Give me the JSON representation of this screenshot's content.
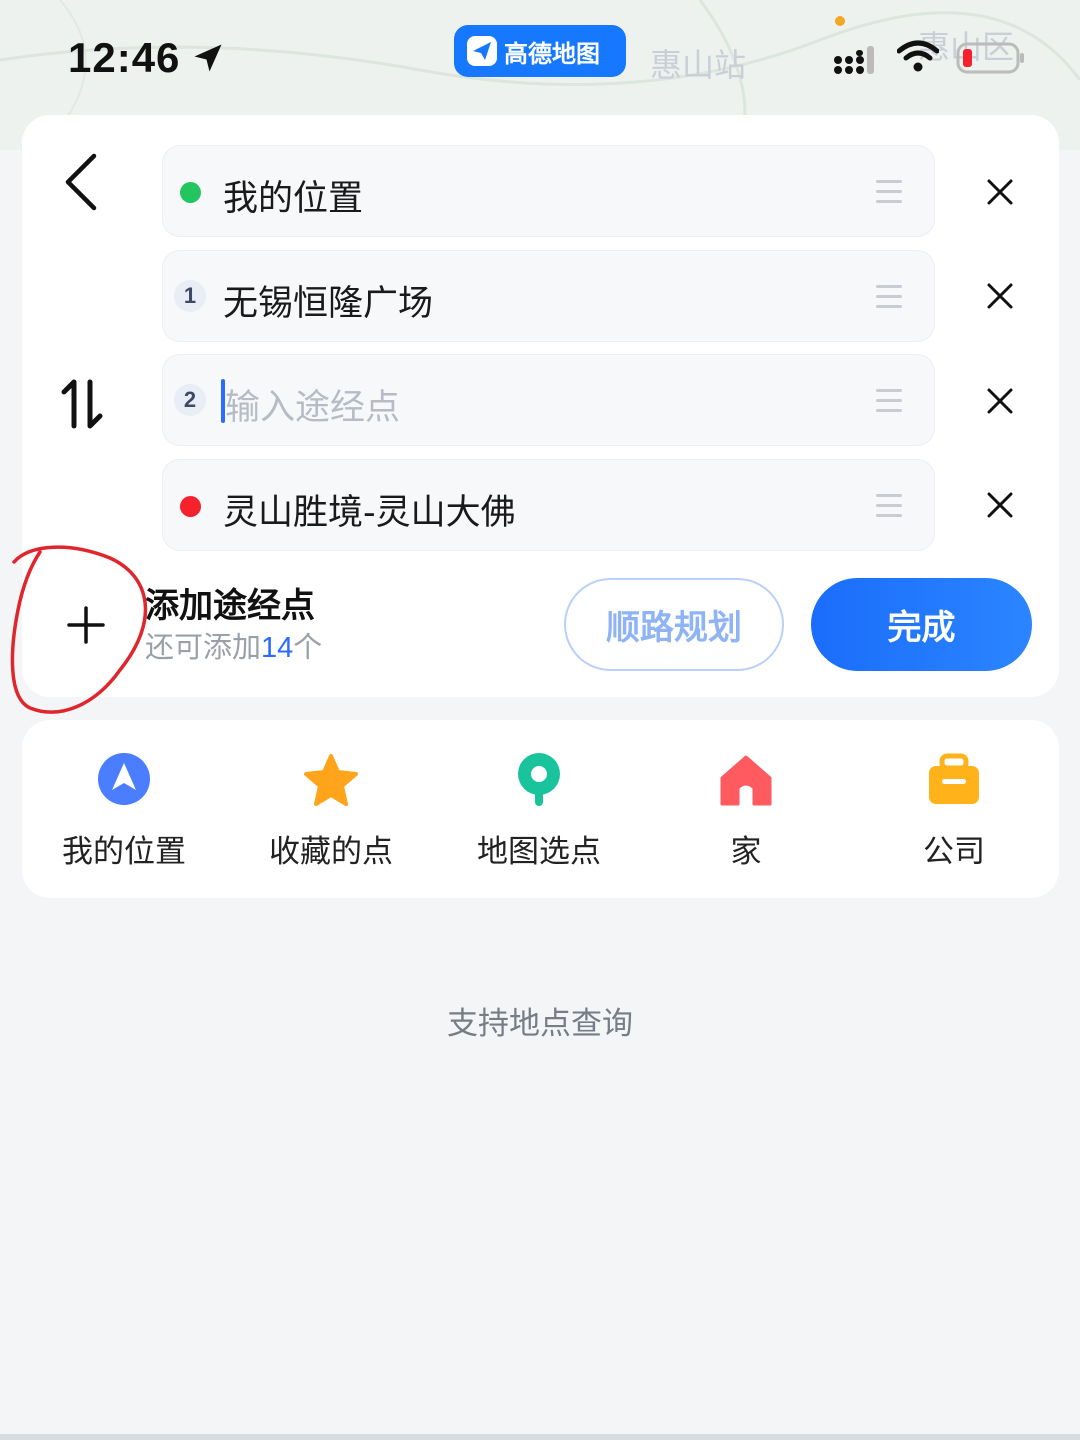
{
  "status_bar": {
    "time": "12:46",
    "app_name": "高德地图"
  },
  "map": {
    "labels": [
      "惠山站",
      "惠山区"
    ]
  },
  "route": {
    "stops": [
      {
        "type": "start",
        "label": "我的位置",
        "color": "#22c55e"
      },
      {
        "type": "waypoint",
        "number": "1",
        "label": "无锡恒隆广场"
      },
      {
        "type": "waypoint-input",
        "number": "2",
        "placeholder": "输入途经点"
      },
      {
        "type": "end",
        "label": "灵山胜境-灵山大佛",
        "color": "#f5222d"
      }
    ],
    "add_waypoint": {
      "title": "添加途经点",
      "sub_prefix": "还可添加",
      "remaining": "14",
      "sub_suffix": "个"
    },
    "plan_button": "顺路规划",
    "done_button": "完成"
  },
  "shortcuts": [
    {
      "label": "我的位置",
      "icon": "navigation-arrow-icon",
      "color": "#4a7dff"
    },
    {
      "label": "收藏的点",
      "icon": "star-icon",
      "color": "#ffa41b"
    },
    {
      "label": "地图选点",
      "icon": "map-pin-icon",
      "color": "#19c39b"
    },
    {
      "label": "家",
      "icon": "home-icon",
      "color": "#ff5a5f"
    },
    {
      "label": "公司",
      "icon": "briefcase-icon",
      "color": "#ffb21a"
    }
  ],
  "hint": "支持地点查询",
  "colors": {
    "accent": "#1a6dfb",
    "annotation": "#e0262d"
  }
}
